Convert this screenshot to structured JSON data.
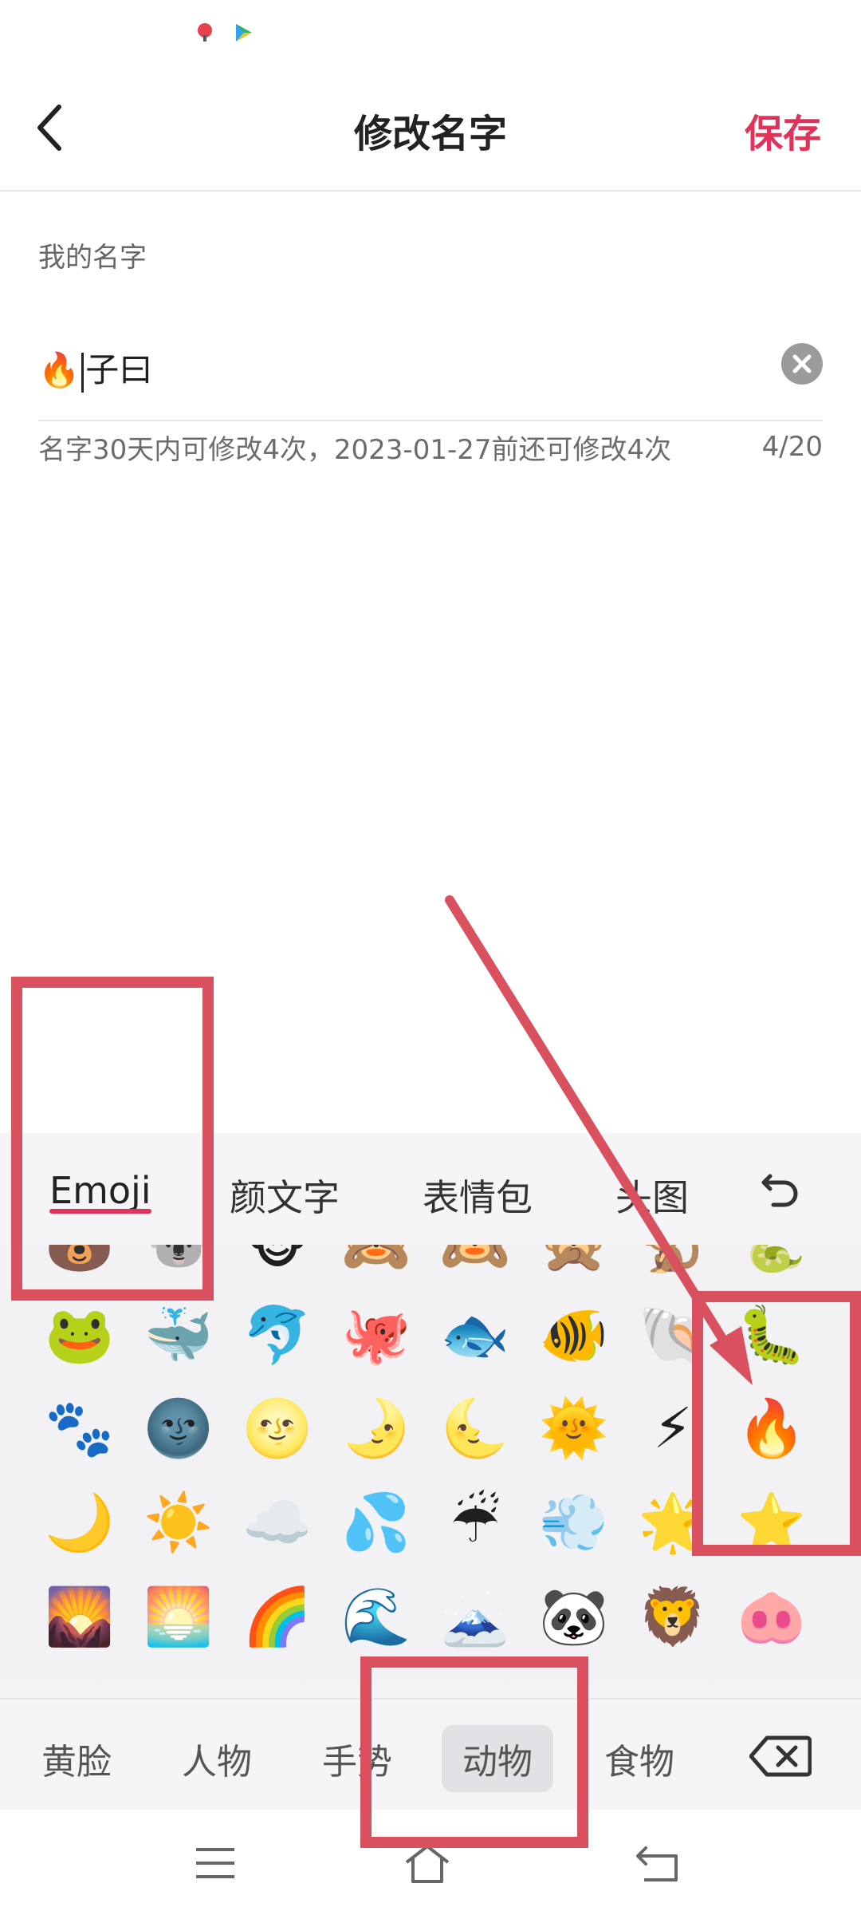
{
  "status": {
    "icons": [
      "map-pin-icon",
      "play-store-icon"
    ]
  },
  "header": {
    "title": "修改名字",
    "save_label": "保存",
    "back_icon": "chevron-left-icon"
  },
  "form": {
    "label": "我的名字",
    "value_emoji": "🔥",
    "value_text": "子曰",
    "hint": "名字30天内可修改4次，2023-01-27前还可修改4次",
    "count": "4/20"
  },
  "keyboard": {
    "tabs": [
      "Emoji",
      "颜文字",
      "表情包",
      "头图"
    ],
    "active_tab": "Emoji",
    "emoji_rows": [
      [
        "🐻",
        "🐨",
        "🐵",
        "🙈",
        "🙉",
        "🙊",
        "🐒",
        "🐍"
      ],
      [
        "🐸",
        "🐳",
        "🐬",
        "🐙",
        "🐟",
        "🐠",
        "🐚",
        "🐛"
      ],
      [
        "🐾",
        "🌚",
        "🌝",
        "🌛",
        "🌜",
        "🌞",
        "⚡",
        "🔥"
      ],
      [
        "🌙",
        "☀️",
        "☁️",
        "💦",
        "☔",
        "💨",
        "🌟",
        "⭐"
      ],
      [
        "🌄",
        "🌅",
        "🌈",
        "🌊",
        "🗻",
        "🐼",
        "🦁",
        "🐽"
      ]
    ],
    "categories": [
      "黄脸",
      "人物",
      "手势",
      "动物",
      "食物"
    ],
    "selected_category": "动物"
  },
  "colors": {
    "accent": "#e3325a",
    "annotation": "#d9505e"
  }
}
